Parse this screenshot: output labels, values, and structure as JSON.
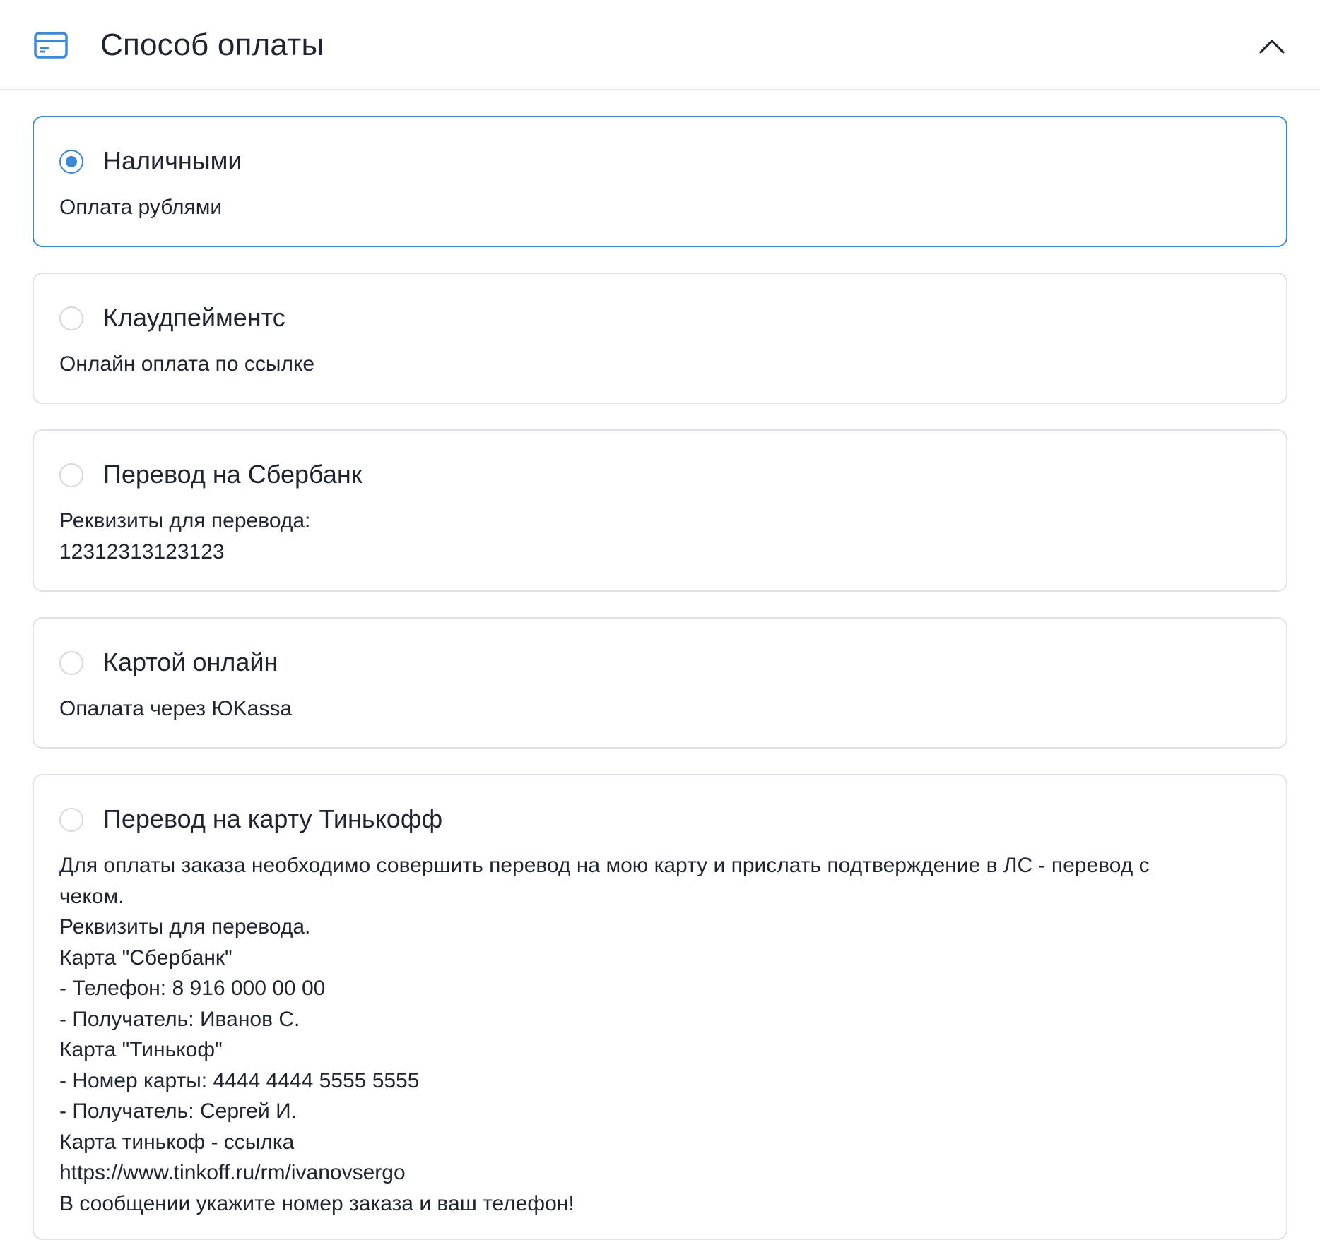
{
  "header": {
    "title": "Способ оплаты",
    "icon": "credit-card-icon",
    "toggle_icon": "chevron-up-icon",
    "accent_color": "#3b8ad9"
  },
  "payment_options": [
    {
      "title": "Наличными",
      "description": "Оплата рублями",
      "selected": true
    },
    {
      "title": "Клаудпейментс",
      "description": "Онлайн оплата по ссылке",
      "selected": false
    },
    {
      "title": "Перевод на Сбербанк",
      "description": "Реквизиты для перевода:\n12312313123123",
      "selected": false
    },
    {
      "title": "Картой онлайн",
      "description": "Опалата через ЮKassa",
      "selected": false
    },
    {
      "title": "Перевод на карту Тинькофф",
      "description": "Для оплаты заказа необходимо совершить перевод на мою карту и прислать подтверждение в ЛС - перевод с чеком.\nРеквизиты для перевода.\nКарта \"Сбербанк\"\n- Телефон: 8 916 000 00 00\n- Получатель: Иванов С.\nКарта \"Тинькоф\"\n- Номер карты: 4444 4444 5555 5555\n- Получатель: Сергей И.\nКарта тинькоф - ссылка\nhttps://www.tinkoff.ru/rm/ivanovsergo\nВ сообщении укажите номер заказа и ваш телефон!",
      "selected": false
    }
  ]
}
